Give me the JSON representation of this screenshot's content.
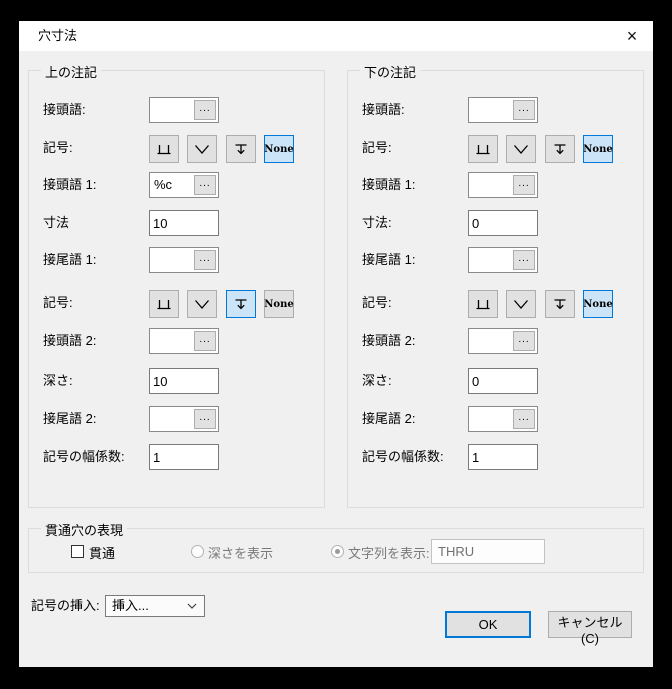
{
  "window": {
    "title": "穴寸法"
  },
  "ui": {
    "ellipsis": "...",
    "none_label": "None",
    "close_glyph": "×"
  },
  "upper_group": {
    "title": "上の注記",
    "prefix": {
      "label": "接頭語:",
      "value": ""
    },
    "symbol_top": {
      "label": "記号:",
      "selected": "None"
    },
    "prefix1": {
      "label": "接頭語 1:",
      "value": "%c"
    },
    "dimension": {
      "label": "寸法",
      "value": "10"
    },
    "suffix1": {
      "label": "接尾語 1:",
      "value": ""
    },
    "symbol_bottom": {
      "label": "記号:",
      "selected": "depth"
    },
    "prefix2": {
      "label": "接頭語 2:",
      "value": ""
    },
    "depth": {
      "label": "深さ:",
      "value": "10"
    },
    "suffix2": {
      "label": "接尾語 2:",
      "value": ""
    },
    "width_factor": {
      "label": "記号の幅係数:",
      "value": "1"
    }
  },
  "lower_group": {
    "title": "下の注記",
    "prefix": {
      "label": "接頭語:",
      "value": ""
    },
    "symbol_top": {
      "label": "記号:",
      "selected": "None"
    },
    "prefix1": {
      "label": "接頭語 1:",
      "value": ""
    },
    "dimension": {
      "label": "寸法:",
      "value": "0"
    },
    "suffix1": {
      "label": "接尾語 1:",
      "value": ""
    },
    "symbol_bottom": {
      "label": "記号:",
      "selected": "None"
    },
    "prefix2": {
      "label": "接頭語 2:",
      "value": ""
    },
    "depth": {
      "label": "深さ:",
      "value": "0"
    },
    "suffix2": {
      "label": "接尾語 2:",
      "value": ""
    },
    "width_factor": {
      "label": "記号の幅係数:",
      "value": "1"
    }
  },
  "through_group": {
    "title": "貫通穴の表現",
    "through_checkbox": {
      "label": "貫通",
      "checked": false
    },
    "show_depth_radio": {
      "label": "深さを表示",
      "selected": false,
      "enabled": false
    },
    "show_text_radio": {
      "label": "文字列を表示:",
      "selected": true,
      "enabled": false
    },
    "text_value": "THRU"
  },
  "footer": {
    "insert_label": "記号の挿入:",
    "insert_value": "挿入...",
    "ok": "OK",
    "cancel": "キャンセル(C)"
  },
  "colors": {
    "accent": "#0078d7",
    "selected_fill": "#cce4f7",
    "dialog_bg": "#f0f0f0",
    "titlebar_bg": "#ffffff",
    "button_face": "#e1e1e1",
    "disabled_text": "#7a7a7a"
  }
}
